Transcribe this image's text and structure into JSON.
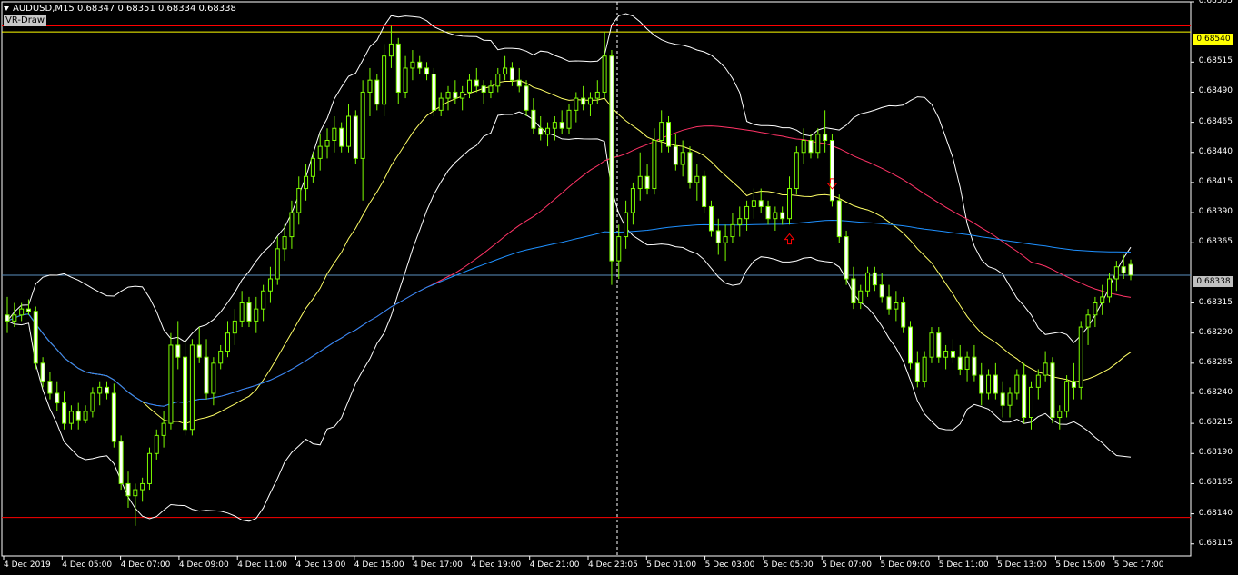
{
  "header": {
    "symbol_line": "AUDUSD,M15  0.68347 0.68351 0.68334 0.68338",
    "indicator_label": "VR-Draw"
  },
  "price_tags": {
    "level_label": "0.68540",
    "bid_label": "0.68338"
  },
  "colors": {
    "background": "#000000",
    "candle_outline": "#7cfc00",
    "candle_bull_fill": "#000000",
    "candle_bear_fill": "#ffffff",
    "bollinger": "#ffffff",
    "ma_fast": "#ffff66",
    "ma_slow": "#ff3366",
    "ma_long": "#1e90ff",
    "hline_red": "#ff0000",
    "hline_yellow": "#ffff00",
    "bid_line": "#5a8fbf",
    "arrow": "#ff0000"
  },
  "chart_data": {
    "type": "candlestick",
    "symbol": "AUDUSD",
    "timeframe": "M15",
    "ylim": [
      0.68105,
      0.68565
    ],
    "y_ticks": [
      "0.68565",
      "0.68540",
      "0.68515",
      "0.68490",
      "0.68465",
      "0.68440",
      "0.68415",
      "0.68390",
      "0.68365",
      "0.68338",
      "0.68315",
      "0.68290",
      "0.68265",
      "0.68240",
      "0.68215",
      "0.68190",
      "0.68165",
      "0.68140",
      "0.68115"
    ],
    "x_labels": [
      "4 Dec 2019",
      "4 Dec 05:00",
      "4 Dec 07:00",
      "4 Dec 09:00",
      "4 Dec 11:00",
      "4 Dec 13:00",
      "4 Dec 15:00",
      "4 Dec 17:00",
      "4 Dec 19:00",
      "4 Dec 21:00",
      "4 Dec 23:05",
      "5 Dec 01:00",
      "5 Dec 03:00",
      "5 Dec 05:00",
      "5 Dec 07:00",
      "5 Dec 09:00",
      "5 Dec 11:00",
      "5 Dec 13:00",
      "5 Dec 15:00",
      "5 Dec 17:00"
    ],
    "horizontal_lines": [
      {
        "price": 0.6854,
        "color": "yellow"
      },
      {
        "price": 0.68545,
        "color": "red"
      },
      {
        "price": 0.68137,
        "color": "red"
      },
      {
        "price": 0.68338,
        "color": "steelblue"
      }
    ],
    "crosshair_time": "4 Dec 23:05",
    "candles": [
      [
        0.68305,
        0.6832,
        0.6829,
        0.683
      ],
      [
        0.683,
        0.68315,
        0.68295,
        0.68305
      ],
      [
        0.68305,
        0.68315,
        0.683,
        0.6831
      ],
      [
        0.6831,
        0.68318,
        0.68305,
        0.68308
      ],
      [
        0.68308,
        0.68312,
        0.6826,
        0.68265
      ],
      [
        0.68265,
        0.6827,
        0.68245,
        0.6825
      ],
      [
        0.6825,
        0.68258,
        0.68235,
        0.6824
      ],
      [
        0.6824,
        0.6825,
        0.68225,
        0.68232
      ],
      [
        0.68232,
        0.68242,
        0.6821,
        0.68215
      ],
      [
        0.68215,
        0.6823,
        0.6821,
        0.68225
      ],
      [
        0.68225,
        0.68232,
        0.6821,
        0.68218
      ],
      [
        0.68218,
        0.6823,
        0.68215,
        0.68225
      ],
      [
        0.68225,
        0.68245,
        0.6822,
        0.6824
      ],
      [
        0.6824,
        0.6825,
        0.6823,
        0.68245
      ],
      [
        0.68245,
        0.6825,
        0.68235,
        0.6824
      ],
      [
        0.6824,
        0.68248,
        0.68195,
        0.682
      ],
      [
        0.682,
        0.68205,
        0.6816,
        0.68165
      ],
      [
        0.68165,
        0.68175,
        0.68145,
        0.68155
      ],
      [
        0.68155,
        0.68165,
        0.6813,
        0.6816
      ],
      [
        0.6816,
        0.6817,
        0.6815,
        0.68165
      ],
      [
        0.68165,
        0.68195,
        0.6816,
        0.6819
      ],
      [
        0.6819,
        0.6821,
        0.68185,
        0.68205
      ],
      [
        0.68205,
        0.68225,
        0.68195,
        0.68215
      ],
      [
        0.68215,
        0.6829,
        0.6821,
        0.6828
      ],
      [
        0.6828,
        0.683,
        0.6826,
        0.6827
      ],
      [
        0.6827,
        0.68285,
        0.68205,
        0.6821
      ],
      [
        0.6821,
        0.68285,
        0.68205,
        0.6828
      ],
      [
        0.6828,
        0.68295,
        0.68265,
        0.6827
      ],
      [
        0.6827,
        0.68285,
        0.68235,
        0.6824
      ],
      [
        0.6824,
        0.6827,
        0.6823,
        0.68265
      ],
      [
        0.68265,
        0.6828,
        0.6826,
        0.68275
      ],
      [
        0.68275,
        0.683,
        0.6827,
        0.6829
      ],
      [
        0.6829,
        0.6831,
        0.6828,
        0.683
      ],
      [
        0.683,
        0.68325,
        0.68295,
        0.68315
      ],
      [
        0.68315,
        0.6832,
        0.68295,
        0.683
      ],
      [
        0.683,
        0.6832,
        0.6829,
        0.6831
      ],
      [
        0.6831,
        0.6833,
        0.683,
        0.68325
      ],
      [
        0.68325,
        0.68345,
        0.68315,
        0.68335
      ],
      [
        0.68335,
        0.6837,
        0.6833,
        0.6836
      ],
      [
        0.6836,
        0.6838,
        0.6835,
        0.6837
      ],
      [
        0.6837,
        0.684,
        0.6836,
        0.6839
      ],
      [
        0.6839,
        0.6842,
        0.6838,
        0.6841
      ],
      [
        0.6841,
        0.6843,
        0.684,
        0.6842
      ],
      [
        0.6842,
        0.6844,
        0.68415,
        0.68435
      ],
      [
        0.68435,
        0.68455,
        0.68425,
        0.68445
      ],
      [
        0.68445,
        0.6846,
        0.68435,
        0.6845
      ],
      [
        0.6845,
        0.6847,
        0.6844,
        0.6846
      ],
      [
        0.6846,
        0.68465,
        0.6844,
        0.68445
      ],
      [
        0.68445,
        0.6848,
        0.6844,
        0.6847
      ],
      [
        0.6847,
        0.68475,
        0.6843,
        0.68435
      ],
      [
        0.68435,
        0.685,
        0.684,
        0.6849
      ],
      [
        0.6849,
        0.6851,
        0.6847,
        0.685
      ],
      [
        0.685,
        0.68505,
        0.68475,
        0.6848
      ],
      [
        0.6848,
        0.6853,
        0.6847,
        0.6852
      ],
      [
        0.6852,
        0.68545,
        0.6851,
        0.6853
      ],
      [
        0.6853,
        0.68535,
        0.6848,
        0.6849
      ],
      [
        0.6849,
        0.6852,
        0.68485,
        0.6851
      ],
      [
        0.6851,
        0.68525,
        0.685,
        0.68515
      ],
      [
        0.68515,
        0.6852,
        0.68505,
        0.6851
      ],
      [
        0.6851,
        0.68515,
        0.685,
        0.68505
      ],
      [
        0.68505,
        0.6851,
        0.6847,
        0.68475
      ],
      [
        0.68475,
        0.6849,
        0.6847,
        0.68485
      ],
      [
        0.68485,
        0.68495,
        0.68475,
        0.6849
      ],
      [
        0.6849,
        0.685,
        0.6848,
        0.68485
      ],
      [
        0.68485,
        0.68495,
        0.68475,
        0.6849
      ],
      [
        0.6849,
        0.68505,
        0.68485,
        0.685
      ],
      [
        0.685,
        0.6851,
        0.6849,
        0.68495
      ],
      [
        0.68495,
        0.685,
        0.6848,
        0.6849
      ],
      [
        0.6849,
        0.685,
        0.68485,
        0.68495
      ],
      [
        0.68495,
        0.6851,
        0.6849,
        0.68505
      ],
      [
        0.68505,
        0.6852,
        0.685,
        0.6851
      ],
      [
        0.6851,
        0.68515,
        0.68495,
        0.685
      ],
      [
        0.685,
        0.6851,
        0.6849,
        0.68495
      ],
      [
        0.68495,
        0.685,
        0.6847,
        0.68475
      ],
      [
        0.68475,
        0.68485,
        0.68455,
        0.6846
      ],
      [
        0.6846,
        0.6847,
        0.6845,
        0.68455
      ],
      [
        0.68455,
        0.68465,
        0.68445,
        0.6846
      ],
      [
        0.6846,
        0.6847,
        0.6845,
        0.68465
      ],
      [
        0.68465,
        0.68475,
        0.68455,
        0.6846
      ],
      [
        0.6846,
        0.6848,
        0.68455,
        0.68475
      ],
      [
        0.68475,
        0.6849,
        0.68465,
        0.68485
      ],
      [
        0.68485,
        0.68495,
        0.68475,
        0.6848
      ],
      [
        0.6848,
        0.6849,
        0.6847,
        0.68485
      ],
      [
        0.68485,
        0.685,
        0.6848,
        0.6849
      ],
      [
        0.6849,
        0.6854,
        0.68485,
        0.6852
      ],
      [
        0.6852,
        0.68525,
        0.6833,
        0.6835
      ],
      [
        0.6835,
        0.6838,
        0.68335,
        0.6837
      ],
      [
        0.6837,
        0.684,
        0.6836,
        0.6839
      ],
      [
        0.6839,
        0.68415,
        0.6838,
        0.6841
      ],
      [
        0.6841,
        0.6844,
        0.684,
        0.6842
      ],
      [
        0.6842,
        0.6843,
        0.68405,
        0.6841
      ],
      [
        0.6841,
        0.6846,
        0.68405,
        0.6845
      ],
      [
        0.6845,
        0.68475,
        0.6844,
        0.68465
      ],
      [
        0.68465,
        0.6847,
        0.6844,
        0.68445
      ],
      [
        0.68445,
        0.68455,
        0.68425,
        0.6843
      ],
      [
        0.6843,
        0.6845,
        0.6842,
        0.6844
      ],
      [
        0.6844,
        0.68445,
        0.6841,
        0.68415
      ],
      [
        0.68415,
        0.6843,
        0.684,
        0.6842
      ],
      [
        0.6842,
        0.68425,
        0.6839,
        0.68395
      ],
      [
        0.68395,
        0.684,
        0.6837,
        0.68375
      ],
      [
        0.68375,
        0.68385,
        0.68355,
        0.68365
      ],
      [
        0.68365,
        0.6838,
        0.6835,
        0.6837
      ],
      [
        0.6837,
        0.6839,
        0.68365,
        0.6838
      ],
      [
        0.6838,
        0.68395,
        0.6837,
        0.68385
      ],
      [
        0.68385,
        0.684,
        0.68375,
        0.68395
      ],
      [
        0.68395,
        0.6841,
        0.68385,
        0.684
      ],
      [
        0.684,
        0.6841,
        0.6839,
        0.68395
      ],
      [
        0.68395,
        0.684,
        0.6838,
        0.68385
      ],
      [
        0.68385,
        0.68395,
        0.68375,
        0.6839
      ],
      [
        0.6839,
        0.68395,
        0.6838,
        0.68385
      ],
      [
        0.68385,
        0.6842,
        0.6838,
        0.6841
      ],
      [
        0.6841,
        0.68445,
        0.68405,
        0.6844
      ],
      [
        0.6844,
        0.6846,
        0.6843,
        0.6845
      ],
      [
        0.6845,
        0.68455,
        0.68435,
        0.6844
      ],
      [
        0.6844,
        0.6846,
        0.68435,
        0.68455
      ],
      [
        0.68455,
        0.68475,
        0.6844,
        0.6845
      ],
      [
        0.6845,
        0.68455,
        0.68395,
        0.684
      ],
      [
        0.684,
        0.68405,
        0.68365,
        0.6837
      ],
      [
        0.6837,
        0.68375,
        0.6833,
        0.68335
      ],
      [
        0.68335,
        0.68345,
        0.6831,
        0.68315
      ],
      [
        0.68315,
        0.6833,
        0.6831,
        0.68325
      ],
      [
        0.68325,
        0.68345,
        0.6832,
        0.6834
      ],
      [
        0.6834,
        0.68345,
        0.68325,
        0.6833
      ],
      [
        0.6833,
        0.6834,
        0.68315,
        0.6832
      ],
      [
        0.6832,
        0.6833,
        0.68305,
        0.6831
      ],
      [
        0.6831,
        0.68325,
        0.683,
        0.68315
      ],
      [
        0.68315,
        0.6832,
        0.6829,
        0.68295
      ],
      [
        0.68295,
        0.683,
        0.6826,
        0.68265
      ],
      [
        0.68265,
        0.68275,
        0.68245,
        0.6825
      ],
      [
        0.6825,
        0.68275,
        0.68245,
        0.6827
      ],
      [
        0.6827,
        0.68295,
        0.68265,
        0.6829
      ],
      [
        0.6829,
        0.68295,
        0.68265,
        0.6827
      ],
      [
        0.6827,
        0.6828,
        0.6826,
        0.68275
      ],
      [
        0.68275,
        0.68285,
        0.68265,
        0.6827
      ],
      [
        0.6827,
        0.6828,
        0.68255,
        0.6826
      ],
      [
        0.6826,
        0.68275,
        0.6825,
        0.6827
      ],
      [
        0.6827,
        0.6828,
        0.6825,
        0.68255
      ],
      [
        0.68255,
        0.68265,
        0.6823,
        0.6824
      ],
      [
        0.6824,
        0.6826,
        0.68235,
        0.68255
      ],
      [
        0.68255,
        0.68265,
        0.68235,
        0.6824
      ],
      [
        0.6824,
        0.6825,
        0.6822,
        0.6823
      ],
      [
        0.6823,
        0.68245,
        0.6822,
        0.6824
      ],
      [
        0.6824,
        0.6826,
        0.68235,
        0.68255
      ],
      [
        0.68255,
        0.68265,
        0.68215,
        0.6822
      ],
      [
        0.6822,
        0.6825,
        0.6821,
        0.68245
      ],
      [
        0.68245,
        0.6826,
        0.68235,
        0.68255
      ],
      [
        0.68255,
        0.68275,
        0.6825,
        0.68265
      ],
      [
        0.68265,
        0.6827,
        0.68215,
        0.6822
      ],
      [
        0.6822,
        0.6823,
        0.6821,
        0.68225
      ],
      [
        0.68225,
        0.68255,
        0.6822,
        0.6825
      ],
      [
        0.6825,
        0.68265,
        0.68235,
        0.68245
      ],
      [
        0.68245,
        0.683,
        0.68235,
        0.68295
      ],
      [
        0.68295,
        0.6831,
        0.6828,
        0.68305
      ],
      [
        0.68305,
        0.6832,
        0.68295,
        0.68315
      ],
      [
        0.68315,
        0.6833,
        0.68305,
        0.6832
      ],
      [
        0.6832,
        0.6834,
        0.68315,
        0.68335
      ],
      [
        0.68335,
        0.6835,
        0.68325,
        0.68345
      ],
      [
        0.68345,
        0.68355,
        0.68335,
        0.6834
      ],
      [
        0.68347,
        0.68351,
        0.68334,
        0.68338
      ]
    ],
    "arrows": [
      {
        "type": "down",
        "candle": 116,
        "price": 0.68412
      },
      {
        "type": "up",
        "candle": 110,
        "price": 0.6837
      }
    ]
  }
}
